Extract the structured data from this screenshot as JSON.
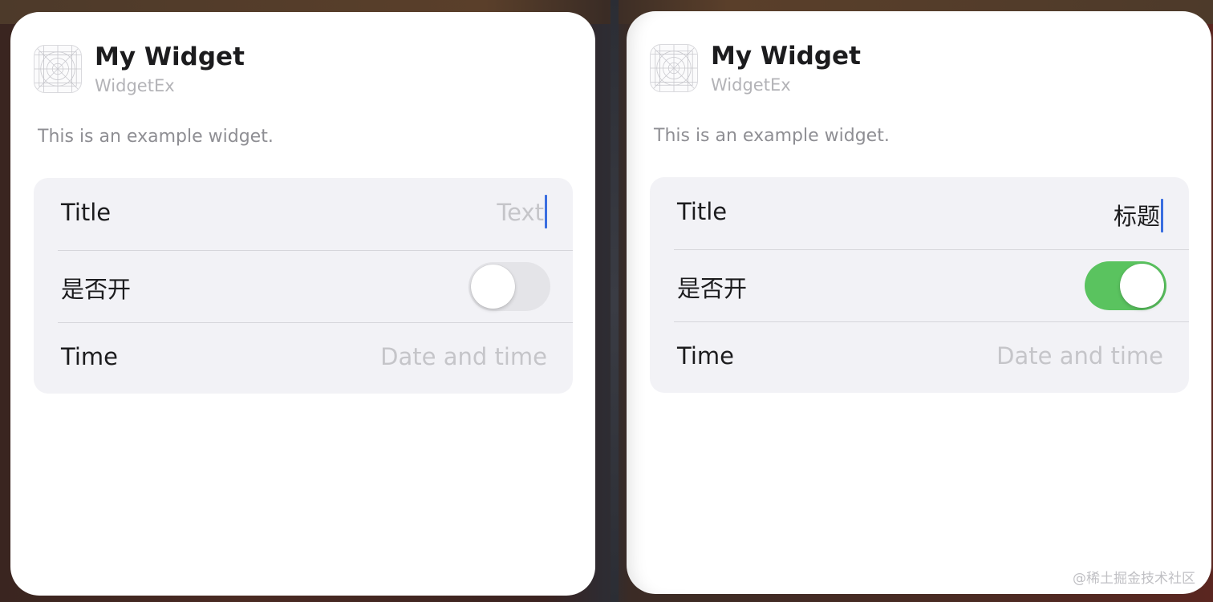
{
  "panels": [
    {
      "widget_name": "My Widget",
      "app_name": "WidgetEx",
      "description": "This is an example widget.",
      "icon": "app-placeholder-grid-icon",
      "rows": {
        "title": {
          "label": "Title",
          "value": "Text",
          "is_placeholder": true
        },
        "toggle": {
          "label": "是否开",
          "state": "off"
        },
        "time": {
          "label": "Time",
          "value": "Date and time",
          "is_placeholder": true
        }
      }
    },
    {
      "widget_name": "My Widget",
      "app_name": "WidgetEx",
      "description": "This is an example widget.",
      "icon": "app-placeholder-grid-icon",
      "rows": {
        "title": {
          "label": "Title",
          "value": "标题",
          "is_placeholder": false
        },
        "toggle": {
          "label": "是否开",
          "state": "on"
        },
        "time": {
          "label": "Time",
          "value": "Date and time",
          "is_placeholder": true
        }
      }
    }
  ],
  "watermark": "@稀土掘金技术社区",
  "colors": {
    "toggle_on": "#5ac35f",
    "toggle_off": "#e4e4e8",
    "caret": "#3a6ee0",
    "group_background": "#f2f2f6",
    "placeholder_text": "#c5c5c9"
  }
}
